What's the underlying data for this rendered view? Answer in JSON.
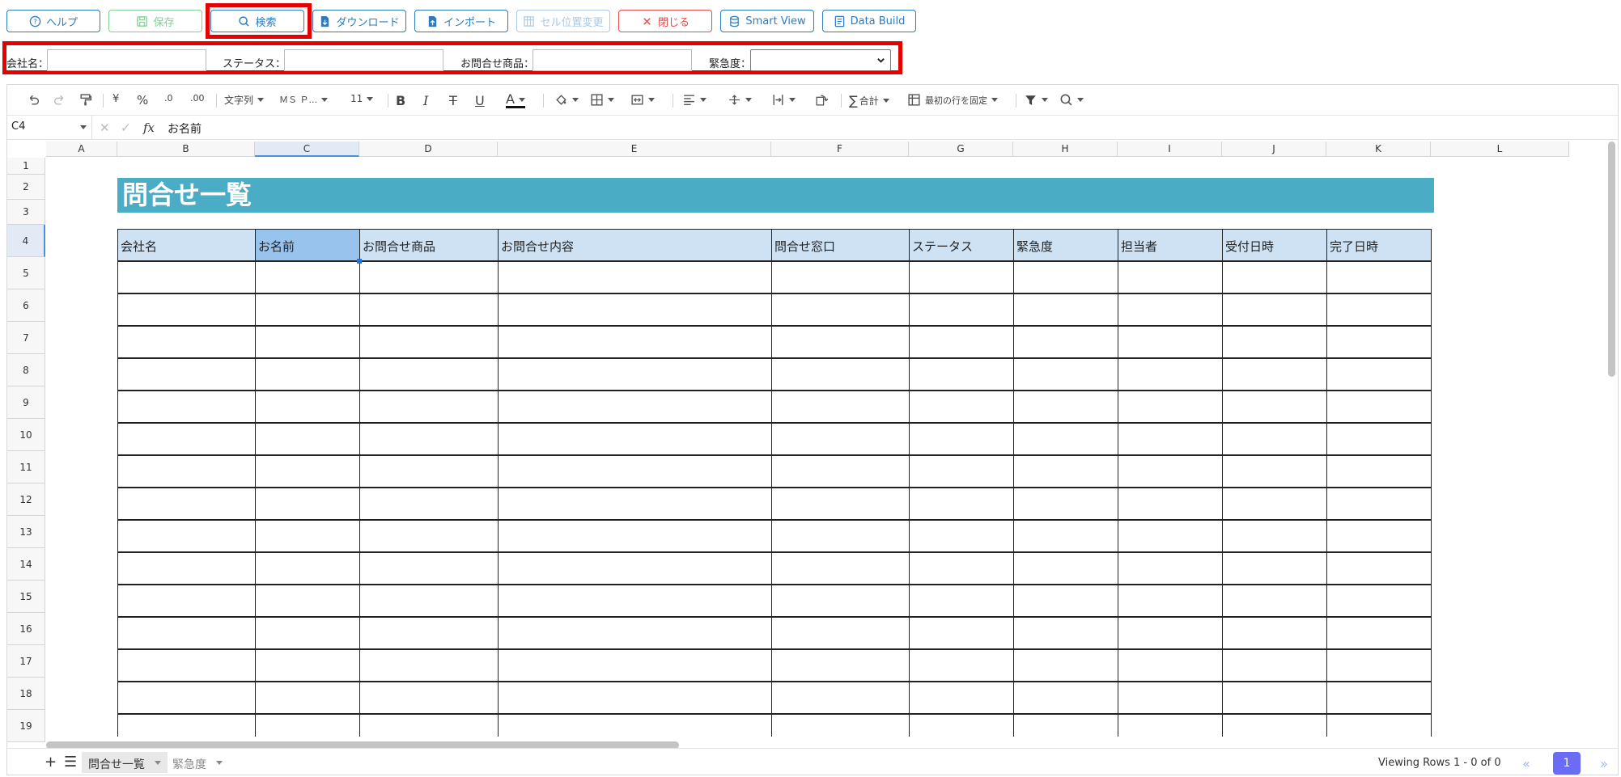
{
  "toolbar": {
    "help": "ヘルプ",
    "save": "保存",
    "search": "検索",
    "download": "ダウンロード",
    "import": "インポート",
    "cell_position": "セル位置変更",
    "close": "閉じる",
    "smart_view": "Smart View",
    "data_build": "Data Build"
  },
  "filters": {
    "company_label": "会社名：",
    "status_label": "ステータス：",
    "product_label": "お問合せ商品：",
    "urgency_label": "緊急度："
  },
  "ribbon": {
    "currency": "¥",
    "percent": "%",
    "dec_inc": ".0",
    "dec_dec": ".00",
    "format": "文字列",
    "font": "ＭＳ Ｐ...",
    "font_size": "11",
    "bold": "B",
    "italic": "I",
    "strike": "T",
    "underline": "U",
    "font_color": "A",
    "sum": "合計",
    "freeze": "最初の行を固定"
  },
  "formula_bar": {
    "cell_ref": "C4",
    "fx": "fx",
    "value": "お名前"
  },
  "columns": [
    "A",
    "B",
    "C",
    "D",
    "E",
    "F",
    "G",
    "H",
    "I",
    "J",
    "K",
    "L"
  ],
  "rows": [
    "1",
    "2",
    "3",
    "4",
    "5",
    "6",
    "7",
    "8",
    "9",
    "10",
    "11",
    "12",
    "13",
    "14",
    "15",
    "16",
    "17",
    "18",
    "19"
  ],
  "sheet": {
    "title": "問合せ一覧",
    "headers": [
      "会社名",
      "お名前",
      "お問合せ商品",
      "お問合せ内容",
      "問合せ窓口",
      "ステータス",
      "緊急度",
      "担当者",
      "受付日時",
      "完了日時"
    ],
    "active_cell": "C4"
  },
  "tabs": [
    {
      "label": "問合せ一覧",
      "active": true
    },
    {
      "label": "緊急度",
      "active": false
    }
  ],
  "status": {
    "viewing": "Viewing Rows 1 - 0 of 0",
    "page": "1",
    "first": "«",
    "last": "»"
  },
  "colors": {
    "accent": "#2c7bbf",
    "title_bg": "#4bacc6",
    "header_bg": "#cfe2f3",
    "highlight": "#e60000",
    "pager": "#6a6cf6"
  }
}
